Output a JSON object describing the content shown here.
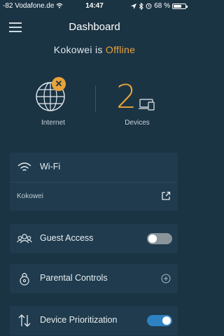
{
  "status_bar": {
    "signal": "-82",
    "carrier": "Vodafone.de",
    "time": "14:47",
    "battery_percent": "68 %",
    "battery_level": 0.68
  },
  "header": {
    "title": "Dashboard"
  },
  "network": {
    "name": "Kokowei",
    "is_text": "is",
    "status": "Offline",
    "status_color": "#e8a33a"
  },
  "internet": {
    "label": "Internet"
  },
  "devices": {
    "count": "2",
    "label": "Devices"
  },
  "wifi": {
    "title": "Wi-Fi",
    "network_name": "Kokowei"
  },
  "guest_access": {
    "title": "Guest Access",
    "enabled": false
  },
  "parental_controls": {
    "title": "Parental Controls"
  },
  "device_prioritization": {
    "title": "Device Prioritization",
    "enabled": true
  },
  "colors": {
    "background": "#1b3444",
    "card": "#1f3b4d",
    "accent": "#e8a33a",
    "toggle_on": "#2e82c2"
  }
}
